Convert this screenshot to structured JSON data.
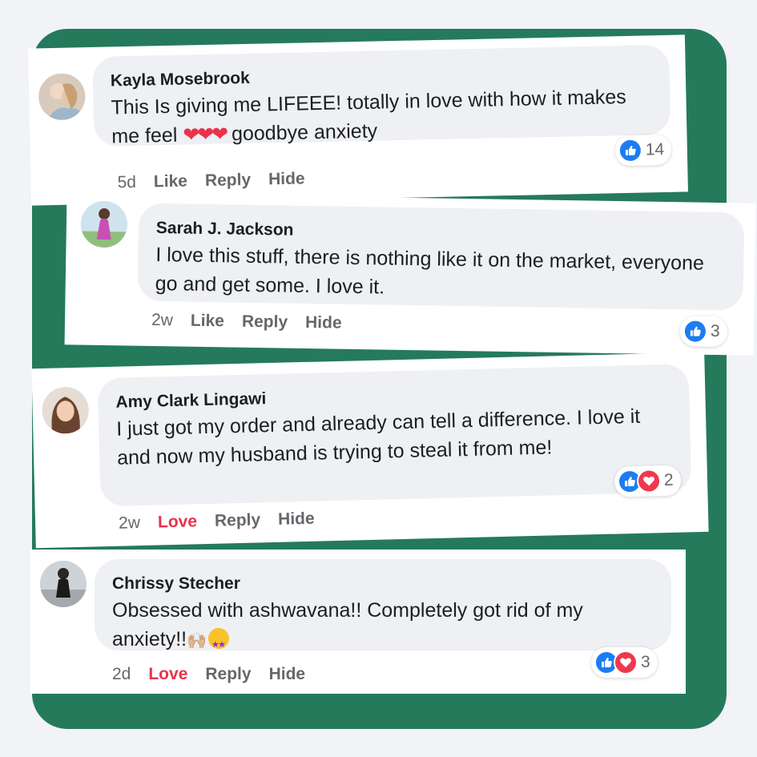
{
  "colors": {
    "page_background": "#f1f3f6",
    "frame_green": "#257a5c",
    "bubble_background": "#eef0f3",
    "like_blue": "#1d7cf2",
    "love_red": "#f0384d",
    "love_text_red": "#e8334a",
    "meta_gray": "#65676b"
  },
  "comments": [
    {
      "author": "Kayla Mosebrook",
      "text": "This Is giving me LIFEEE! totally in love with how it makes me feel",
      "hearts": "❤❤❤",
      "text_end": "goodbye anxiety",
      "reaction_icons": [
        "like-icon"
      ],
      "reaction_count": "14",
      "time": "5d",
      "action_label": "Like",
      "reply_label": "Reply",
      "hide_label": "Hide"
    },
    {
      "author": "Sarah J. Jackson",
      "text": "I love this stuff, there is nothing like it on the market, everyone go and get some. I love it.",
      "reaction_icons": [
        "like-icon"
      ],
      "reaction_count": "3",
      "time": "2w",
      "action_label": "Like",
      "reply_label": "Reply",
      "hide_label": "Hide"
    },
    {
      "author": "Amy Clark Lingawi",
      "text": "I just got my order and already can tell a difference. I love it and now my husband is trying to steal it from me!",
      "reaction_icons": [
        "like-icon",
        "love-icon"
      ],
      "reaction_count": "2",
      "time": "2w",
      "action_label": "Love",
      "reply_label": "Reply",
      "hide_label": "Hide"
    },
    {
      "author": "Chrissy Stecher",
      "text": "Obsessed with ashwavana!! Completely got rid of my anxiety!!",
      "emoji_hands": "🙌🏼",
      "emoji_star": "star-struck-emoji",
      "reaction_icons": [
        "like-icon",
        "love-icon"
      ],
      "reaction_count": "3",
      "time": "2d",
      "action_label": "Love",
      "reply_label": "Reply",
      "hide_label": "Hide"
    }
  ]
}
